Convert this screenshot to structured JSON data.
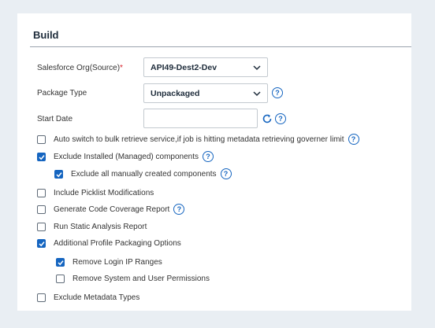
{
  "section": {
    "title": "Build"
  },
  "fields": {
    "org_label": "Salesforce Org(Source)",
    "org_required": "*",
    "org_value": "API49-Dest2-Dev",
    "package_label": "Package Type",
    "package_value": "Unpackaged",
    "start_date_label": "Start Date",
    "start_date_value": ""
  },
  "options": [
    {
      "label": "Auto switch to bulk retrieve service,if job is hitting metadata retrieving governer limit",
      "checked": false
    },
    {
      "label": "Exclude Installed (Managed) components",
      "checked": true
    },
    {
      "label": "Exclude all manually created components",
      "checked": true
    },
    {
      "label": "Include Picklist Modifications",
      "checked": false
    },
    {
      "label": "Generate Code Coverage Report",
      "checked": false
    },
    {
      "label": "Run Static Analysis Report",
      "checked": false
    },
    {
      "label": "Additional Profile Packaging Options",
      "checked": true
    },
    {
      "label": "Remove Login IP Ranges",
      "checked": true
    },
    {
      "label": "Remove System and User Permissions",
      "checked": false
    },
    {
      "label": "Exclude Metadata Types",
      "checked": false
    }
  ],
  "icons": {
    "help": "?",
    "help_color": "#1565c0",
    "checkbox_color": "#1565c0"
  }
}
